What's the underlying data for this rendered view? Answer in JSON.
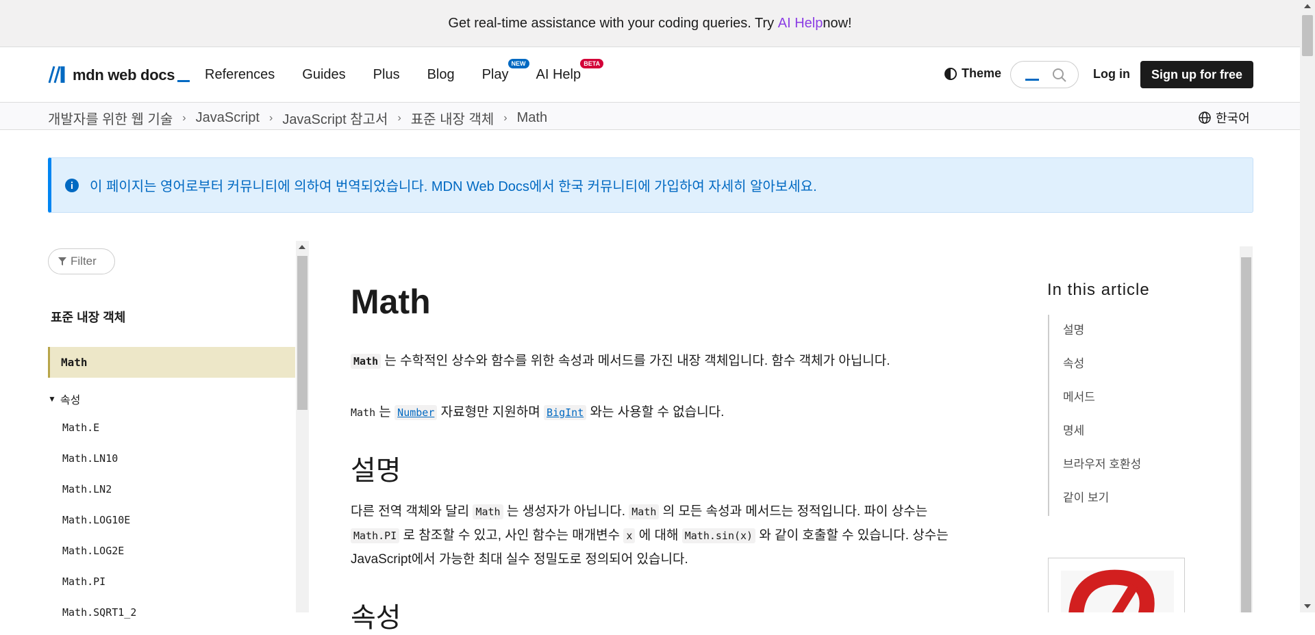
{
  "banner": {
    "text_before": "Get real-time assistance with your coding queries. Try ",
    "link": "AI Help",
    "text_after": " now!"
  },
  "header": {
    "logo_text": "mdn web docs",
    "nav": [
      {
        "label": "References"
      },
      {
        "label": "Guides"
      },
      {
        "label": "Plus"
      },
      {
        "label": "Blog"
      },
      {
        "label": "Play",
        "badge": "NEW"
      },
      {
        "label": "AI Help",
        "badge": "BETA"
      }
    ],
    "theme_label": "Theme",
    "login_label": "Log in",
    "signup_label": "Sign up for free"
  },
  "breadcrumb": {
    "items": [
      "개발자를 위한 웹 기술",
      "JavaScript",
      "JavaScript 참고서",
      "표준 내장 객체",
      "Math"
    ],
    "language": "한국어"
  },
  "notice": {
    "text": "이 페이지는 영어로부터 커뮤니티에 의하여 번역되었습니다. MDN Web Docs에서 한국 커뮤니티에 가입하여 자세히 알아보세요."
  },
  "sidebar": {
    "filter_label": "Filter",
    "title": "표준 내장 객체",
    "active_item": "Math",
    "group_label": "속성",
    "links": [
      "Math.E",
      "Math.LN10",
      "Math.LN2",
      "Math.LOG10E",
      "Math.LOG2E",
      "Math.PI",
      "Math.SQRT1_2"
    ]
  },
  "main": {
    "title": "Math",
    "intro": {
      "code": "Math",
      "text": " 는 수학적인 상수와 함수를 위한 속성과 메서드를 가진 내장 객체입니다. 함수 객체가 아닙니다."
    },
    "note": {
      "code1": "Math",
      "text1": " 는 ",
      "link1": "Number",
      "text2": " 자료형만 지원하며 ",
      "link2": "BigInt",
      "text3": " 와는 사용할 수 없습니다."
    },
    "section1_title": "설명",
    "desc": {
      "t1": "다른 전역 객체와 달리 ",
      "c1": "Math",
      "t2": " 는 생성자가 아닙니다. ",
      "c2": "Math",
      "t3": " 의 모든 속성과 메서드는 정적입니다. 파이 상수는",
      "c3": "Math.PI",
      "t4": " 로 참조할 수 있고, 사인 함수는 매개변수 ",
      "c4": "x",
      "t5": " 에 대해 ",
      "c5": "Math.sin(x)",
      "t6": " 와 같이 호출할 수 있습니다. 상수는",
      "t7": "JavaScript에서 가능한 최대 실수 정밀도로 정의되어 있습니다."
    },
    "section2_title": "속성"
  },
  "toc": {
    "title": "In this article",
    "items": [
      "설명",
      "속성",
      "메서드",
      "명세",
      "브라우저 호환성",
      "같이 보기"
    ]
  },
  "colors": {
    "accent_blue": "#0069c2",
    "ai_purple": "#8b3de4",
    "active_bg": "#ede7c8",
    "notice_bg": "#e0f0fd"
  }
}
